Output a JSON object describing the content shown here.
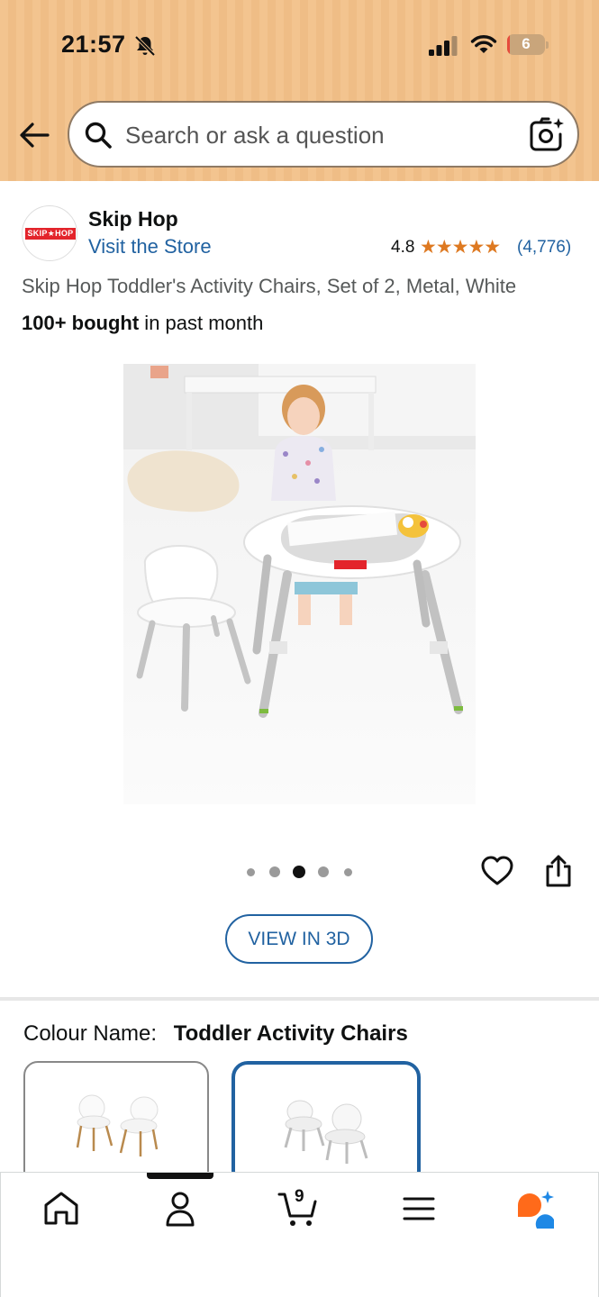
{
  "status_bar": {
    "time": "21:57",
    "battery": "6",
    "battery_level": 0.06
  },
  "search": {
    "placeholder": "Search or ask a question"
  },
  "seller": {
    "logo_text": "SKIP★HOP",
    "name": "Skip Hop",
    "visit_label": "Visit the Store",
    "rating": "4.8",
    "stars": "★★★★★",
    "rating_count": "(4,776)"
  },
  "product": {
    "title": "Skip Hop Toddler's Activity Chairs, Set of 2, Metal, White",
    "bought_bold": "100+ bought",
    "bought_rest": " in past month",
    "image_count": 5,
    "current_image": 3,
    "view3d_label": "VIEW IN 3D"
  },
  "variation": {
    "label": "Colour Name:",
    "value": "Toddler Activity Chairs",
    "selected_index": 1
  },
  "bottom_nav": {
    "items": [
      "home-icon",
      "account-icon",
      "cart-icon",
      "menu-icon",
      "rufus-icon"
    ],
    "cart_count": "9",
    "active_index": 1
  },
  "colors": {
    "accent_blue": "#2162a1",
    "star_orange": "#de7921",
    "header_bg": "#f3c48f"
  }
}
